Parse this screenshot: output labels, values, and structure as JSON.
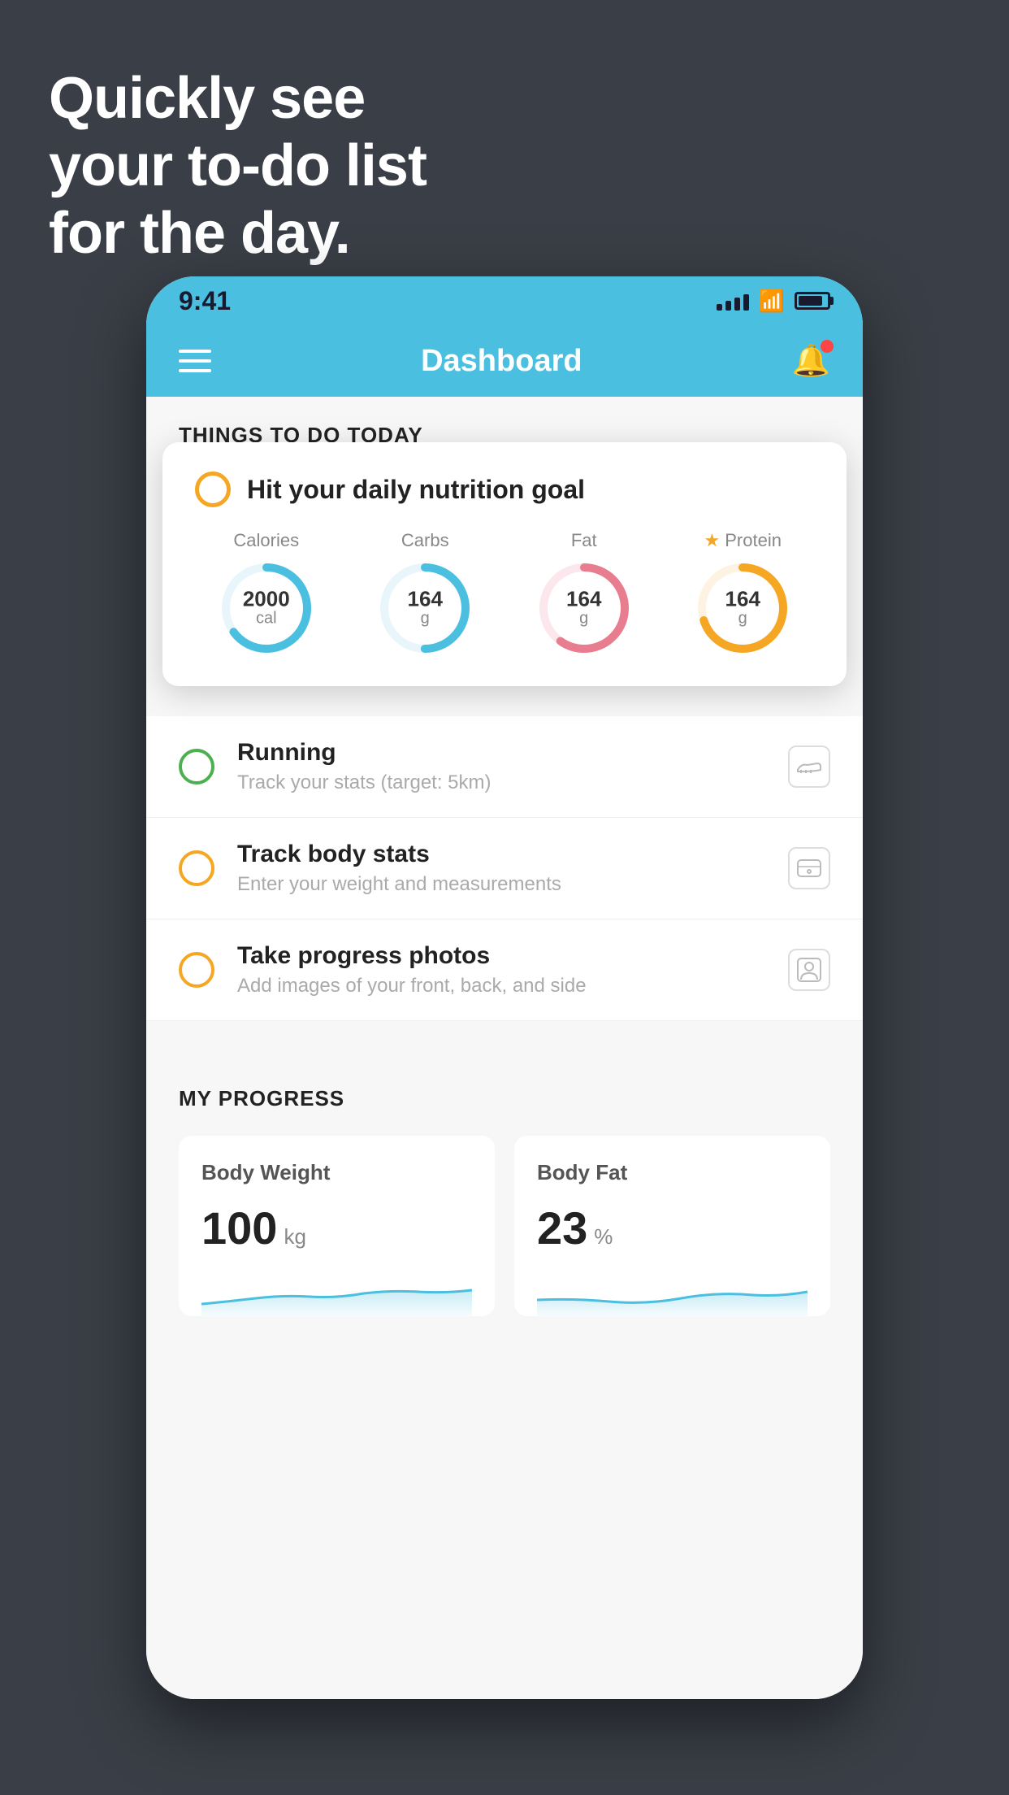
{
  "headline": {
    "line1": "Quickly see",
    "line2": "your to-do list",
    "line3": "for the day."
  },
  "statusBar": {
    "time": "9:41",
    "signalBars": [
      8,
      12,
      16,
      20
    ],
    "batteryPercent": 85
  },
  "navBar": {
    "title": "Dashboard"
  },
  "thingsToDo": {
    "sectionTitle": "THINGS TO DO TODAY",
    "featuredCard": {
      "icon": "circle-outline-yellow",
      "title": "Hit your daily nutrition goal",
      "nutrients": [
        {
          "label": "Calories",
          "value": "2000",
          "unit": "cal",
          "color": "#4bbfe0",
          "percentage": 65
        },
        {
          "label": "Carbs",
          "value": "164",
          "unit": "g",
          "color": "#4bbfe0",
          "percentage": 50
        },
        {
          "label": "Fat",
          "value": "164",
          "unit": "g",
          "color": "#e87d8f",
          "percentage": 60
        },
        {
          "label": "Protein",
          "value": "164",
          "unit": "g",
          "color": "#f5a623",
          "percentage": 70,
          "starred": true
        }
      ]
    },
    "todoItems": [
      {
        "id": "running",
        "circleColor": "green",
        "title": "Running",
        "subtitle": "Track your stats (target: 5km)",
        "icon": "shoe-icon"
      },
      {
        "id": "track-body-stats",
        "circleColor": "yellow",
        "title": "Track body stats",
        "subtitle": "Enter your weight and measurements",
        "icon": "scale-icon"
      },
      {
        "id": "progress-photos",
        "circleColor": "yellow",
        "title": "Take progress photos",
        "subtitle": "Add images of your front, back, and side",
        "icon": "person-icon"
      }
    ]
  },
  "myProgress": {
    "sectionTitle": "MY PROGRESS",
    "cards": [
      {
        "id": "body-weight",
        "title": "Body Weight",
        "value": "100",
        "unit": "kg",
        "chartColor": "#4bbfe0"
      },
      {
        "id": "body-fat",
        "title": "Body Fat",
        "value": "23",
        "unit": "%",
        "chartColor": "#4bbfe0"
      }
    ]
  },
  "colors": {
    "background": "#3a3f47",
    "appBlue": "#4bbfe0",
    "yellow": "#f5a623",
    "green": "#4caf50",
    "pink": "#e87d8f",
    "cardBg": "#ffffff"
  }
}
